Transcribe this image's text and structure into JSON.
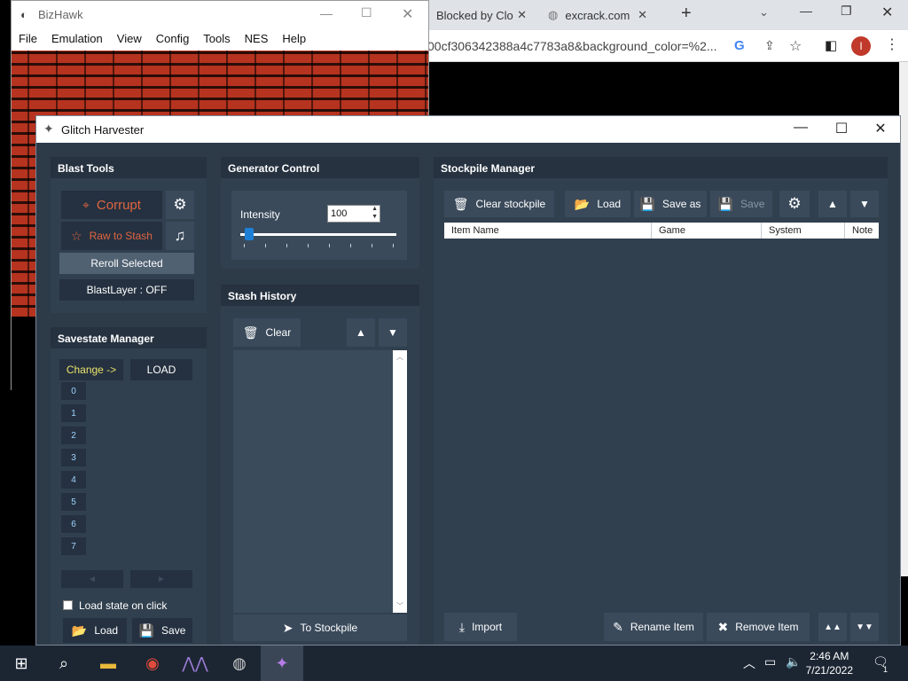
{
  "browser": {
    "tabs": [
      {
        "label": "Blocked by Clo",
        "close": "✕"
      },
      {
        "label": "excrack.com",
        "close": "✕"
      }
    ],
    "new_tab": "+",
    "url": "00cf306342388a4c7783a8&background_color=%2...",
    "profile_initial": "I"
  },
  "bizhawk": {
    "title": "BizHawk",
    "menu": [
      "File",
      "Emulation",
      "View",
      "Config",
      "Tools",
      "NES",
      "Help"
    ]
  },
  "gh": {
    "title": "Glitch Harvester",
    "blast_tools": {
      "header": "Blast Tools",
      "corrupt": "Corrupt",
      "raw_to_stash": "Raw to Stash",
      "reroll": "Reroll Selected",
      "blastlayer": "BlastLayer : OFF"
    },
    "generator": {
      "header": "Generator Control",
      "intensity_label": "Intensity",
      "intensity_value": "100",
      "slider_level": 0.03
    },
    "stash": {
      "header": "Stash History",
      "clear": "Clear",
      "to_stockpile": "To Stockpile"
    },
    "savestate": {
      "header": "Savestate Manager",
      "change": "Change ->",
      "load": "LOAD",
      "slots": [
        "0",
        "1",
        "2",
        "3",
        "4",
        "5",
        "6",
        "7"
      ],
      "prev": "◄",
      "next": "►",
      "load_on_click": "Load state on click",
      "load_btn": "Load",
      "save_btn": "Save"
    },
    "stockpile": {
      "header": "Stockpile Manager",
      "clear": "Clear stockpile",
      "load": "Load",
      "save_as": "Save as",
      "save": "Save",
      "columns": [
        "Item Name",
        "Game",
        "System",
        "Note"
      ],
      "import": "Import",
      "rename": "Rename Item",
      "remove": "Remove Item"
    }
  },
  "taskbar": {
    "time": "2:46 AM",
    "date": "7/21/2022",
    "notif": "1"
  }
}
